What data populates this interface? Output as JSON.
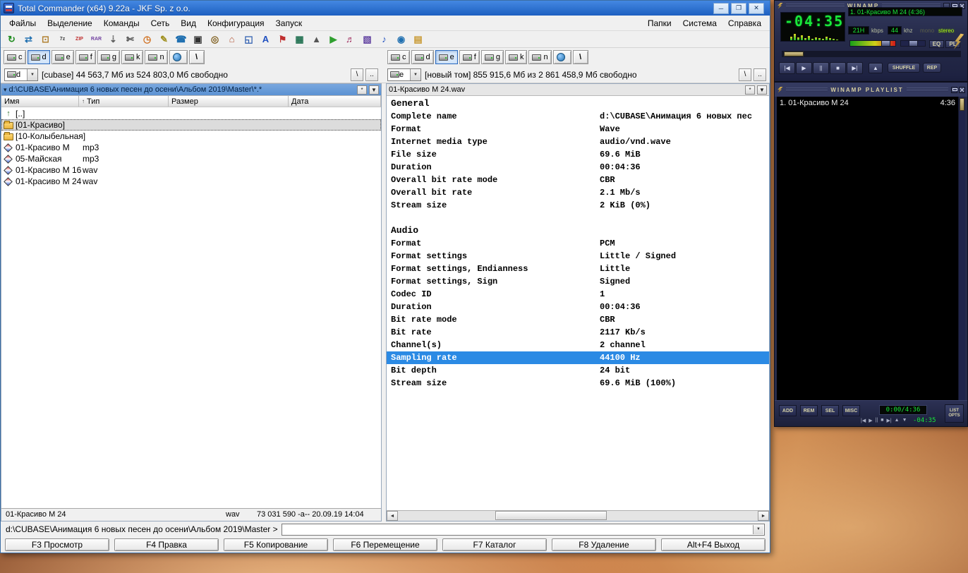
{
  "tc": {
    "title": "Total Commander (x64) 9.22a - JKF Sp. z o.o.",
    "window_buttons": {
      "minimize": "─",
      "maximize": "❐",
      "close": "✕"
    },
    "menu": [
      "Файлы",
      "Выделение",
      "Команды",
      "Сеть",
      "Вид",
      "Конфигурация",
      "Запуск"
    ],
    "menu_right": [
      "Папки",
      "Система",
      "Справка"
    ],
    "glyphs": {
      "caret_down": "▼",
      "asterisk": "*",
      "path_menu": "▾",
      "scroll_left": "◄",
      "scroll_right": "►",
      "up_dir": "↑",
      "root": "\\",
      "parent": ".."
    },
    "toolbar": [
      {
        "name": "refresh-icon",
        "glyph": "↻",
        "color": "#1f8c1f"
      },
      {
        "name": "swap-panels-icon",
        "glyph": "⇄",
        "color": "#1f6fb0"
      },
      {
        "name": "copy-icon",
        "glyph": "⊡",
        "color": "#b08030"
      },
      {
        "name": "pack-7z-icon",
        "glyph": "7z",
        "color": "#404040"
      },
      {
        "name": "pack-zip-icon",
        "glyph": "ZIP",
        "color": "#c03030"
      },
      {
        "name": "pack-rar-icon",
        "glyph": "RAR",
        "color": "#7040a0"
      },
      {
        "name": "unpack-icon",
        "glyph": "⇣",
        "color": "#606060"
      },
      {
        "name": "cut-icon",
        "glyph": "✄",
        "color": "#606060"
      },
      {
        "name": "clock-icon",
        "glyph": "◷",
        "color": "#d07020"
      },
      {
        "name": "notes-icon",
        "glyph": "✎",
        "color": "#a09020"
      },
      {
        "name": "ftp-icon",
        "glyph": "☎",
        "color": "#1f6fb0"
      },
      {
        "name": "terminal-icon",
        "glyph": "▣",
        "color": "#303030"
      },
      {
        "name": "search-icon",
        "glyph": "◎",
        "color": "#806020"
      },
      {
        "name": "home-icon",
        "glyph": "⌂",
        "color": "#b05030"
      },
      {
        "name": "tv-icon",
        "glyph": "◱",
        "color": "#3060b0"
      },
      {
        "name": "charmap-icon",
        "glyph": "A",
        "color": "#2050c0"
      },
      {
        "name": "flag-icon",
        "glyph": "⚑",
        "color": "#c03030"
      },
      {
        "name": "grid-icon",
        "glyph": "▦",
        "color": "#207050"
      },
      {
        "name": "eject-icon",
        "glyph": "▲",
        "color": "#555555"
      },
      {
        "name": "media-player-icon",
        "glyph": "▶",
        "color": "#2f9f2f"
      },
      {
        "name": "mixer-icon",
        "glyph": "♬",
        "color": "#a03060"
      },
      {
        "name": "image-icon",
        "glyph": "▧",
        "color": "#6040a0"
      },
      {
        "name": "music-icon",
        "glyph": "♪",
        "color": "#2050c0"
      },
      {
        "name": "internet-icon",
        "glyph": "◉",
        "color": "#1f6fb0"
      },
      {
        "name": "folder-icon",
        "glyph": "▤",
        "color": "#c89830"
      }
    ],
    "left": {
      "drives": [
        "c",
        "d",
        "e",
        "f",
        "g",
        "k",
        "n"
      ],
      "active_drive": "d",
      "drive_combo": "d",
      "drive_info": "[cubase]  44 563,7 Мб из 524 803,0 Мб свободно",
      "path": "d:\\CUBASE\\Анимация 6 новых песен до осени\\Альбом 2019\\Master\\*.*",
      "columns": [
        {
          "label": "Имя",
          "sort": ""
        },
        {
          "label": "Тип",
          "sort": "↑"
        },
        {
          "label": "Размер",
          "sort": ""
        },
        {
          "label": "Дата",
          "sort": ""
        }
      ],
      "files": [
        {
          "name": "[..]",
          "type": "",
          "icon": "up",
          "cursor": false
        },
        {
          "name": "[01-Красиво]",
          "type": "",
          "icon": "folder",
          "cursor": true
        },
        {
          "name": "[10-Колыбельная]",
          "type": "",
          "icon": "folder",
          "cursor": false
        },
        {
          "name": "01-Красиво М",
          "type": "mp3",
          "icon": "audio",
          "cursor": false
        },
        {
          "name": "05-Майская",
          "type": "mp3",
          "icon": "audio",
          "cursor": false
        },
        {
          "name": "01-Красиво М 16",
          "type": "wav",
          "icon": "audio",
          "cursor": false
        },
        {
          "name": "01-Красиво М 24",
          "type": "wav",
          "icon": "audio",
          "cursor": false
        }
      ],
      "status": {
        "name": "01-Красиво М 24",
        "type": "wav",
        "details": "73 031 590 -a-- 20.09.19 14:04"
      }
    },
    "right": {
      "drives": [
        "c",
        "d",
        "e",
        "f",
        "g",
        "k",
        "n"
      ],
      "active_drive": "e",
      "drive_combo": "e",
      "drive_info": "[новый том]  855 915,6 Мб из 2 861 458,9 Мб свободно",
      "path": "01-Красиво М 24.wav",
      "info": [
        {
          "title": "General",
          "rows": [
            {
              "k": "Complete name",
              "v": "d:\\CUBASE\\Анимация 6 новых пес",
              "selected": false
            },
            {
              "k": "Format",
              "v": "Wave",
              "selected": false
            },
            {
              "k": "Internet media type",
              "v": "audio/vnd.wave",
              "selected": false
            },
            {
              "k": "File size",
              "v": "69.6 MiB",
              "selected": false
            },
            {
              "k": "Duration",
              "v": "00:04:36",
              "selected": false
            },
            {
              "k": "Overall bit rate mode",
              "v": "CBR",
              "selected": false
            },
            {
              "k": "Overall bit rate",
              "v": "2.1 Mb/s",
              "selected": false
            },
            {
              "k": "Stream size",
              "v": "2 KiB (0%)",
              "selected": false
            }
          ]
        },
        {
          "title": "Audio",
          "rows": [
            {
              "k": "Format",
              "v": "PCM",
              "selected": false
            },
            {
              "k": "Format settings",
              "v": "Little / Signed",
              "selected": false
            },
            {
              "k": "Format settings, Endianness",
              "v": "Little",
              "selected": false
            },
            {
              "k": "Format settings, Sign",
              "v": "Signed",
              "selected": false
            },
            {
              "k": "Codec ID",
              "v": "1",
              "selected": false
            },
            {
              "k": "Duration",
              "v": "00:04:36",
              "selected": false
            },
            {
              "k": "Bit rate mode",
              "v": "CBR",
              "selected": false
            },
            {
              "k": "Bit rate",
              "v": "2117 Kb/s",
              "selected": false
            },
            {
              "k": "Channel(s)",
              "v": "2 channel",
              "selected": false
            },
            {
              "k": "Sampling rate",
              "v": "44100 Hz",
              "selected": true
            },
            {
              "k": "Bit depth",
              "v": "24 bit",
              "selected": false
            },
            {
              "k": "Stream size",
              "v": "69.6 MiB (100%)",
              "selected": false
            }
          ]
        }
      ]
    },
    "cmdline": {
      "prompt": "d:\\CUBASE\\Анимация 6 новых песен до осени\\Альбом 2019\\Master >"
    },
    "fkeys": [
      "F3 Просмотр",
      "F4 Правка",
      "F5 Копирование",
      "F6 Перемещение",
      "F7 Каталог",
      "F8 Удаление",
      "Alt+F4 Выход"
    ]
  },
  "wa": {
    "main": {
      "title": "WINAMP",
      "time": "-04:35",
      "track": "1. 01-Красиво М 24 (4:36)",
      "kbps": "21H",
      "kbps_label": "kbps",
      "khz": "44",
      "khz_label": "khz",
      "mono_label": "mono",
      "stereo_label": "stereo",
      "eq_label": "EQ",
      "pl_label": "PL",
      "shuffle_label": "SHUFFLE",
      "repeat_label": "REP",
      "transport": [
        "|◀",
        "▶",
        "||",
        "■",
        "▶|"
      ],
      "eject_glyph": "▲",
      "vis_levels": [
        5,
        9,
        4,
        7,
        3,
        6,
        2,
        4,
        3,
        2,
        5,
        3,
        2,
        1
      ]
    },
    "playlist": {
      "title": "WINAMP PLAYLIST",
      "items": [
        {
          "label": "1. 01-Красиво М 24",
          "time": "4:36"
        }
      ],
      "buttons": [
        "ADD",
        "REM",
        "SEL",
        "MISC"
      ],
      "time_display": "0:00/4:36",
      "remaining": "-04:35",
      "list_button": "LIST OPTS",
      "mini_transport": [
        "|◀",
        "▶",
        "||",
        "■",
        "▶|",
        "▲",
        "▼"
      ]
    }
  }
}
